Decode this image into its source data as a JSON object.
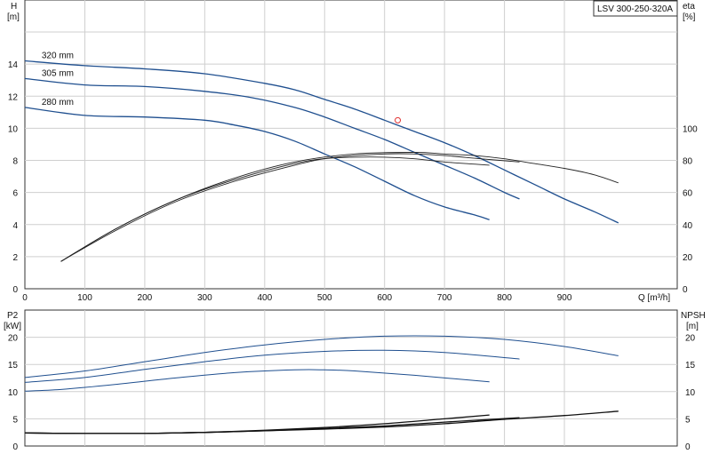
{
  "chart_data": [
    {
      "type": "line",
      "model_label": "LSV 300-250-320A",
      "xlabel": "Q [m³/h]",
      "ylabel_left": [
        "H",
        "[m]"
      ],
      "ylabel_right": [
        "eta",
        "[%]"
      ],
      "xlim": [
        0,
        1000
      ],
      "ylim_left": [
        0,
        16
      ],
      "ylim_right": [
        0,
        160
      ],
      "x_ticks": [
        0,
        100,
        200,
        300,
        400,
        500,
        600,
        700,
        800,
        900
      ],
      "y_ticks_left": [
        0,
        2,
        4,
        6,
        8,
        10,
        12,
        14
      ],
      "y_ticks_right": [
        0,
        20,
        40,
        60,
        80,
        100
      ],
      "grid": true,
      "series": [
        {
          "name": "320 mm",
          "kind": "head",
          "color": "#1f4f8f",
          "x": [
            0,
            100,
            200,
            300,
            400,
            450,
            500,
            550,
            600,
            650,
            700,
            750,
            800,
            850,
            900,
            950,
            990
          ],
          "y": [
            14.2,
            13.9,
            13.7,
            13.4,
            12.8,
            12.4,
            11.8,
            11.2,
            10.5,
            9.8,
            9.1,
            8.3,
            7.4,
            6.5,
            5.6,
            4.8,
            4.1
          ]
        },
        {
          "name": "305 mm",
          "kind": "head",
          "color": "#1f4f8f",
          "x": [
            0,
            100,
            200,
            300,
            380,
            450,
            500,
            550,
            600,
            650,
            700,
            750,
            800,
            825
          ],
          "y": [
            13.1,
            12.7,
            12.6,
            12.3,
            11.9,
            11.3,
            10.7,
            10.0,
            9.3,
            8.5,
            7.7,
            6.9,
            6.0,
            5.6
          ]
        },
        {
          "name": "280 mm",
          "kind": "head",
          "color": "#1f4f8f",
          "x": [
            0,
            100,
            200,
            300,
            350,
            400,
            450,
            500,
            550,
            600,
            650,
            700,
            750,
            775
          ],
          "y": [
            11.3,
            10.8,
            10.7,
            10.5,
            10.2,
            9.8,
            9.2,
            8.4,
            7.6,
            6.7,
            5.8,
            5.1,
            4.6,
            4.3
          ]
        },
        {
          "name": "",
          "kind": "eta",
          "color": "#222222",
          "x": [
            60,
            150,
            250,
            350,
            450,
            550,
            650,
            700,
            750,
            800,
            850,
            900,
            950,
            990
          ],
          "y": [
            17,
            37,
            55,
            69,
            79,
            84,
            85,
            84,
            83,
            81,
            78,
            75,
            71,
            66
          ]
        },
        {
          "name": "",
          "kind": "eta",
          "color": "#222222",
          "x": [
            60,
            150,
            250,
            350,
            450,
            520,
            600,
            650,
            700,
            760,
            825
          ],
          "y": [
            17,
            37,
            55,
            68,
            78,
            82,
            84,
            84,
            83,
            81,
            79
          ]
        },
        {
          "name": "",
          "kind": "eta",
          "color": "#222222",
          "x": [
            60,
            150,
            250,
            350,
            450,
            500,
            550,
            600,
            650,
            700,
            775
          ],
          "y": [
            17,
            36,
            54,
            67,
            77,
            81,
            82,
            82,
            81,
            79,
            77
          ]
        }
      ],
      "duty_point": {
        "x": 622,
        "y": 10.5
      }
    },
    {
      "type": "line",
      "ylabel_left": [
        "P2",
        "[kW]"
      ],
      "ylabel_right": [
        "NPSH",
        "[m]"
      ],
      "xlim": [
        0,
        1000
      ],
      "ylim_left": [
        0,
        25
      ],
      "ylim_right": [
        0,
        25
      ],
      "y_ticks_left": [
        0,
        5,
        10,
        15,
        20
      ],
      "y_ticks_right": [
        0,
        5,
        10,
        15,
        20
      ],
      "grid": true,
      "series": [
        {
          "name": "",
          "kind": "p2",
          "color": "#1f4f8f",
          "x": [
            0,
            100,
            200,
            300,
            400,
            500,
            600,
            700,
            800,
            900,
            990
          ],
          "y": [
            12.6,
            13.8,
            15.5,
            17.2,
            18.6,
            19.6,
            20.2,
            20.2,
            19.6,
            18.3,
            16.6
          ]
        },
        {
          "name": "",
          "kind": "p2",
          "color": "#1f4f8f",
          "x": [
            0,
            100,
            200,
            300,
            400,
            500,
            600,
            700,
            825
          ],
          "y": [
            11.7,
            12.6,
            14.1,
            15.5,
            16.7,
            17.4,
            17.6,
            17.2,
            16.0
          ]
        },
        {
          "name": "",
          "kind": "p2",
          "color": "#1f4f8f",
          "x": [
            0,
            60,
            150,
            250,
            350,
            450,
            500,
            550,
            650,
            775
          ],
          "y": [
            10.1,
            10.4,
            11.3,
            12.5,
            13.5,
            14.0,
            14.0,
            13.8,
            13.0,
            11.8
          ]
        },
        {
          "name": "",
          "kind": "npsh",
          "color": "#111111",
          "x": [
            0,
            100,
            200,
            300,
            400,
            500,
            600,
            700,
            800,
            900,
            990
          ],
          "y": [
            2.4,
            2.3,
            2.3,
            2.5,
            2.8,
            3.1,
            3.5,
            4.1,
            4.9,
            5.6,
            6.4
          ]
        },
        {
          "name": "",
          "kind": "npsh",
          "color": "#111111",
          "x": [
            0,
            100,
            200,
            300,
            400,
            500,
            600,
            700,
            825
          ],
          "y": [
            2.4,
            2.3,
            2.3,
            2.5,
            2.8,
            3.2,
            3.7,
            4.4,
            5.2
          ]
        },
        {
          "name": "",
          "kind": "npsh",
          "color": "#111111",
          "x": [
            0,
            100,
            200,
            300,
            400,
            500,
            600,
            700,
            775
          ],
          "y": [
            2.4,
            2.3,
            2.3,
            2.5,
            2.9,
            3.4,
            4.1,
            5.0,
            5.7
          ]
        }
      ]
    }
  ]
}
